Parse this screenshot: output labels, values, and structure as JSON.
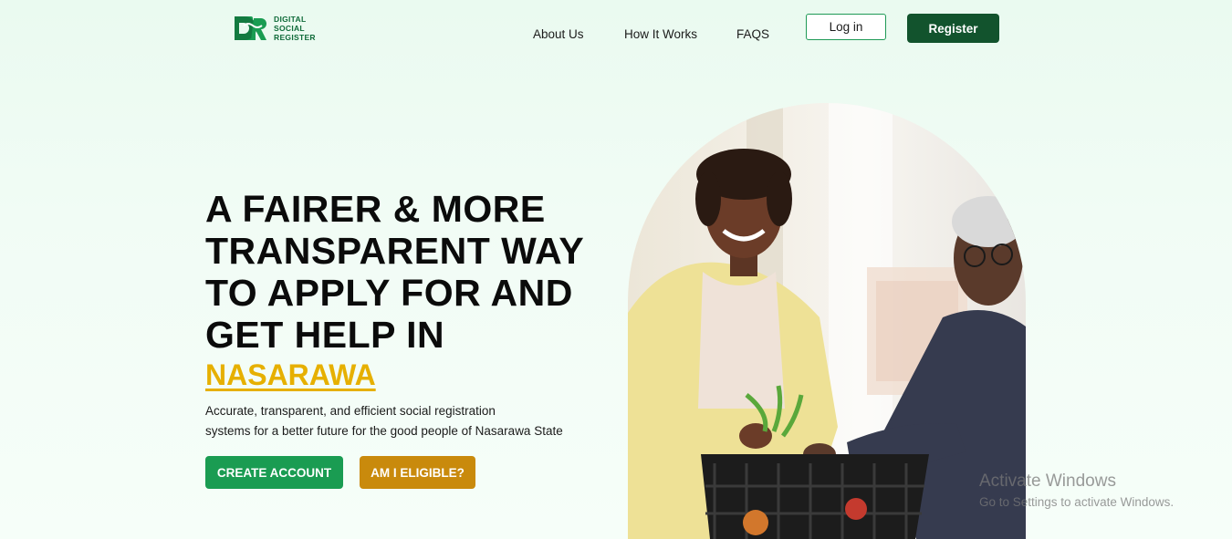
{
  "brand": {
    "mark": "DSR",
    "name_lines": [
      "DIGITAL",
      "SOCIAL",
      "REGISTER"
    ],
    "color": "#0f6a39"
  },
  "nav": {
    "about": "About Us",
    "how": "How It Works",
    "faqs": "FAQS",
    "login": "Log in",
    "register": "Register"
  },
  "hero": {
    "title": "A FAIRER & MORE TRANSPARENT WAY TO APPLY FOR AND GET HELP IN",
    "state": "NASARAWA",
    "description_line1": "Accurate, transparent, and efficient social registration",
    "description_line2": "systems for a better future for the good people of Nasarawa State",
    "create_account": "CREATE ACCOUNT",
    "eligible": "AM I ELIGIBLE?",
    "photo_subject": "woman-handing-grocery-basket-to-elderly-man"
  },
  "watermark": {
    "title": "Activate Windows",
    "subtitle": "Go to Settings to activate Windows."
  },
  "colors": {
    "accent_green": "#1a9c52",
    "dark_green": "#12532d",
    "gold": "#e6b000",
    "amber_button": "#c98a0c"
  }
}
